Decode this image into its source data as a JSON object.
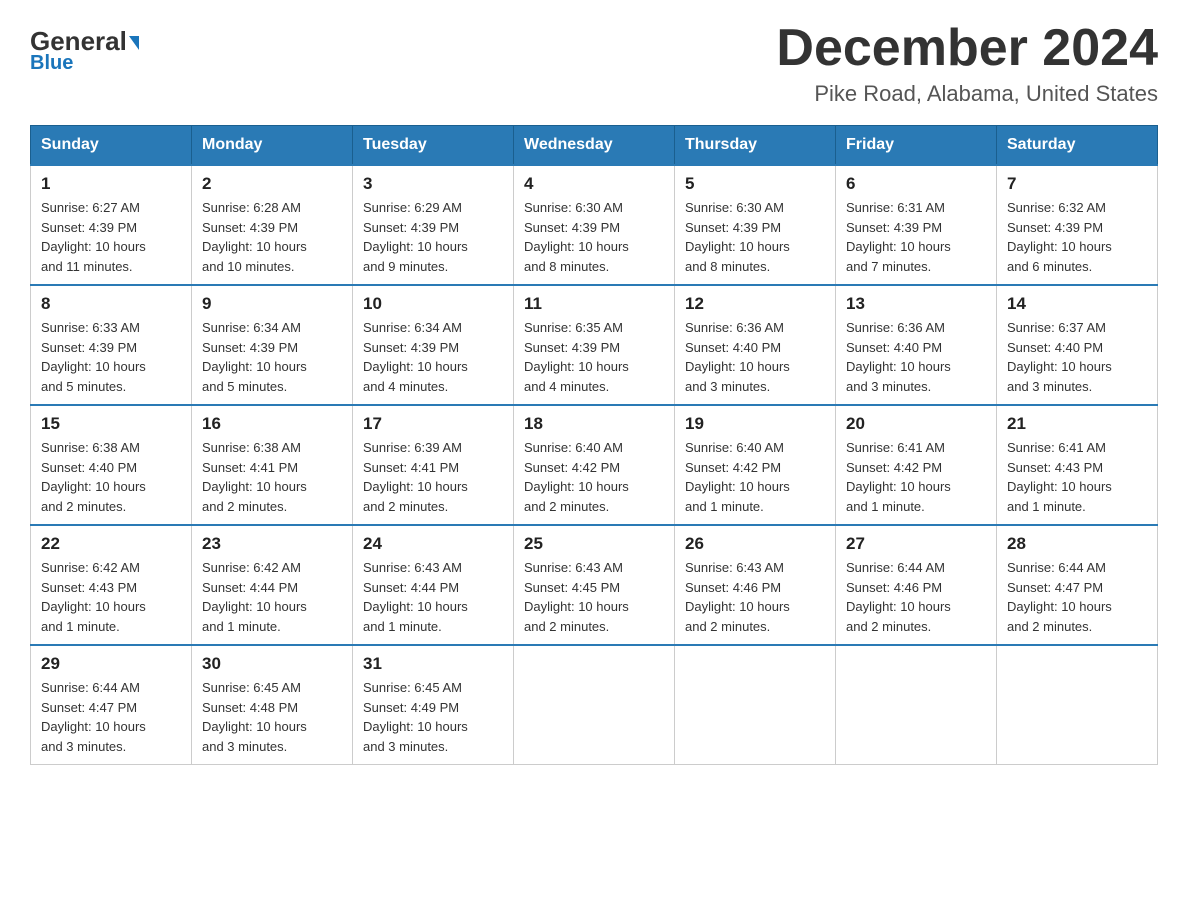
{
  "logo": {
    "general": "General",
    "blue": "Blue",
    "tagline": "Blue"
  },
  "header": {
    "title": "December 2024",
    "subtitle": "Pike Road, Alabama, United States"
  },
  "weekdays": [
    "Sunday",
    "Monday",
    "Tuesday",
    "Wednesday",
    "Thursday",
    "Friday",
    "Saturday"
  ],
  "weeks": [
    [
      {
        "day": "1",
        "sunrise": "6:27 AM",
        "sunset": "4:39 PM",
        "daylight": "10 hours and 11 minutes."
      },
      {
        "day": "2",
        "sunrise": "6:28 AM",
        "sunset": "4:39 PM",
        "daylight": "10 hours and 10 minutes."
      },
      {
        "day": "3",
        "sunrise": "6:29 AM",
        "sunset": "4:39 PM",
        "daylight": "10 hours and 9 minutes."
      },
      {
        "day": "4",
        "sunrise": "6:30 AM",
        "sunset": "4:39 PM",
        "daylight": "10 hours and 8 minutes."
      },
      {
        "day": "5",
        "sunrise": "6:30 AM",
        "sunset": "4:39 PM",
        "daylight": "10 hours and 8 minutes."
      },
      {
        "day": "6",
        "sunrise": "6:31 AM",
        "sunset": "4:39 PM",
        "daylight": "10 hours and 7 minutes."
      },
      {
        "day": "7",
        "sunrise": "6:32 AM",
        "sunset": "4:39 PM",
        "daylight": "10 hours and 6 minutes."
      }
    ],
    [
      {
        "day": "8",
        "sunrise": "6:33 AM",
        "sunset": "4:39 PM",
        "daylight": "10 hours and 5 minutes."
      },
      {
        "day": "9",
        "sunrise": "6:34 AM",
        "sunset": "4:39 PM",
        "daylight": "10 hours and 5 minutes."
      },
      {
        "day": "10",
        "sunrise": "6:34 AM",
        "sunset": "4:39 PM",
        "daylight": "10 hours and 4 minutes."
      },
      {
        "day": "11",
        "sunrise": "6:35 AM",
        "sunset": "4:39 PM",
        "daylight": "10 hours and 4 minutes."
      },
      {
        "day": "12",
        "sunrise": "6:36 AM",
        "sunset": "4:40 PM",
        "daylight": "10 hours and 3 minutes."
      },
      {
        "day": "13",
        "sunrise": "6:36 AM",
        "sunset": "4:40 PM",
        "daylight": "10 hours and 3 minutes."
      },
      {
        "day": "14",
        "sunrise": "6:37 AM",
        "sunset": "4:40 PM",
        "daylight": "10 hours and 3 minutes."
      }
    ],
    [
      {
        "day": "15",
        "sunrise": "6:38 AM",
        "sunset": "4:40 PM",
        "daylight": "10 hours and 2 minutes."
      },
      {
        "day": "16",
        "sunrise": "6:38 AM",
        "sunset": "4:41 PM",
        "daylight": "10 hours and 2 minutes."
      },
      {
        "day": "17",
        "sunrise": "6:39 AM",
        "sunset": "4:41 PM",
        "daylight": "10 hours and 2 minutes."
      },
      {
        "day": "18",
        "sunrise": "6:40 AM",
        "sunset": "4:42 PM",
        "daylight": "10 hours and 2 minutes."
      },
      {
        "day": "19",
        "sunrise": "6:40 AM",
        "sunset": "4:42 PM",
        "daylight": "10 hours and 1 minute."
      },
      {
        "day": "20",
        "sunrise": "6:41 AM",
        "sunset": "4:42 PM",
        "daylight": "10 hours and 1 minute."
      },
      {
        "day": "21",
        "sunrise": "6:41 AM",
        "sunset": "4:43 PM",
        "daylight": "10 hours and 1 minute."
      }
    ],
    [
      {
        "day": "22",
        "sunrise": "6:42 AM",
        "sunset": "4:43 PM",
        "daylight": "10 hours and 1 minute."
      },
      {
        "day": "23",
        "sunrise": "6:42 AM",
        "sunset": "4:44 PM",
        "daylight": "10 hours and 1 minute."
      },
      {
        "day": "24",
        "sunrise": "6:43 AM",
        "sunset": "4:44 PM",
        "daylight": "10 hours and 1 minute."
      },
      {
        "day": "25",
        "sunrise": "6:43 AM",
        "sunset": "4:45 PM",
        "daylight": "10 hours and 2 minutes."
      },
      {
        "day": "26",
        "sunrise": "6:43 AM",
        "sunset": "4:46 PM",
        "daylight": "10 hours and 2 minutes."
      },
      {
        "day": "27",
        "sunrise": "6:44 AM",
        "sunset": "4:46 PM",
        "daylight": "10 hours and 2 minutes."
      },
      {
        "day": "28",
        "sunrise": "6:44 AM",
        "sunset": "4:47 PM",
        "daylight": "10 hours and 2 minutes."
      }
    ],
    [
      {
        "day": "29",
        "sunrise": "6:44 AM",
        "sunset": "4:47 PM",
        "daylight": "10 hours and 3 minutes."
      },
      {
        "day": "30",
        "sunrise": "6:45 AM",
        "sunset": "4:48 PM",
        "daylight": "10 hours and 3 minutes."
      },
      {
        "day": "31",
        "sunrise": "6:45 AM",
        "sunset": "4:49 PM",
        "daylight": "10 hours and 3 minutes."
      },
      null,
      null,
      null,
      null
    ]
  ]
}
